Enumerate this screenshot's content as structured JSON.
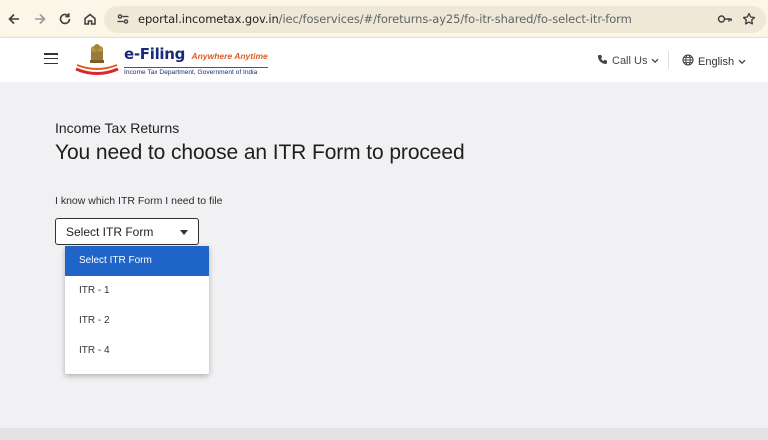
{
  "browser": {
    "url_domain": "eportal.incometax.gov.in",
    "url_path": "/iec/foservices/#/foreturns-ay25/fo-itr-shared/fo-select-itr-form",
    "icons": [
      "back-icon",
      "forward-icon",
      "reload-icon",
      "home-icon",
      "site-info-icon",
      "password-key-icon",
      "bookmark-star-icon"
    ]
  },
  "header": {
    "brand_title": "e-Filing",
    "brand_tagline": "Anywhere Anytime",
    "brand_subtitle": "Income Tax Department, Government of India",
    "call_us": "Call Us",
    "language": "English"
  },
  "main": {
    "section_label": "Income Tax Returns",
    "page_title": "You need to choose an ITR Form to proceed",
    "field_label": "I know which ITR Form I need to file",
    "select_value": "Select ITR Form",
    "options": [
      "Select ITR Form",
      "ITR - 1",
      "ITR - 2",
      "ITR - 4"
    ]
  },
  "colors": {
    "accent": "#1f64c7",
    "brand_blue": "#1a2a7a",
    "brand_orange": "#e35a1d",
    "browser_bar": "#fcf6e8"
  }
}
